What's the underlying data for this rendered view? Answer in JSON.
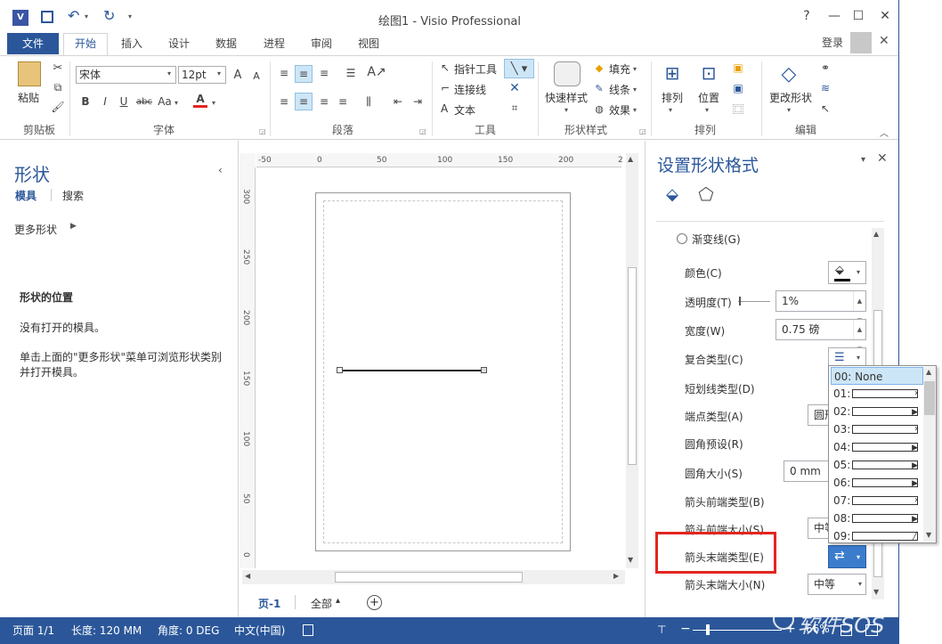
{
  "window": {
    "title": "绘图1 - Visio Professional",
    "help": "?",
    "minimize": "—",
    "restore": "☐",
    "close": "✕",
    "signin": "登录"
  },
  "tabs": [
    "文件",
    "开始",
    "插入",
    "设计",
    "数据",
    "进程",
    "审阅",
    "视图"
  ],
  "ribbon": {
    "clipboard": {
      "paste": "粘贴",
      "label": "剪贴板"
    },
    "font": {
      "name": "宋体",
      "size": "12pt",
      "bold": "B",
      "italic": "I",
      "underline": "U",
      "strike": "abc",
      "case": "Aa",
      "color": "A",
      "label": "字体"
    },
    "paragraph": {
      "label": "段落"
    },
    "tools": {
      "pointer": "指针工具",
      "connector": "连接线",
      "text": "文本",
      "text_icon": "A",
      "label": "工具"
    },
    "shape_styles": {
      "quick": "快速样式",
      "fill": "填充",
      "line": "线条",
      "effect": "效果",
      "label": "形状样式"
    },
    "arrange": {
      "arrange": "排列",
      "position": "位置",
      "label": "排列"
    },
    "editing": {
      "change_shape": "更改形状",
      "label": "编辑"
    }
  },
  "shapes_pane": {
    "title": "形状",
    "tab_stencils": "模具",
    "tab_search": "搜索",
    "more_shapes": "更多形状",
    "section_title": "形状的位置",
    "msg1": "没有打开的模具。",
    "msg2": "单击上面的\"更多形状\"菜单可浏览形状类别并打开模具。"
  },
  "ruler": {
    "h_labels": [
      "-50",
      "0",
      "50",
      "100",
      "150",
      "200",
      "2"
    ],
    "v_labels": [
      "300",
      "250",
      "200",
      "150",
      "100",
      "50",
      "0"
    ]
  },
  "page_tabs": {
    "page1": "页-1",
    "all": "全部",
    "all_arrow": "▴",
    "add": "+"
  },
  "format_pane": {
    "title": "设置形状格式",
    "gradient_line": "渐变线(G)",
    "color": "颜色(C)",
    "transparency": "透明度(T)",
    "transparency_value": "1%",
    "width": "宽度(W)",
    "width_value": "0.75 磅",
    "compound": "复合类型(C)",
    "dash": "短划线类型(D)",
    "cap": "端点类型(A)",
    "cap_value": "圆形",
    "round_preset": "圆角预设(R)",
    "round_size": "圆角大小(S)",
    "round_size_value": "0 mm",
    "begin_arrow": "箭头前端类型(B)",
    "begin_size": "箭头前端大小(S)",
    "begin_size_value": "中等",
    "end_arrow": "箭头末端类型(E)",
    "end_size": "箭头末端大小(N)",
    "end_size_value": "中等"
  },
  "arrow_dropdown": {
    "items": [
      "00: None",
      "01:",
      "02:",
      "03:",
      "04:",
      "05:",
      "06:",
      "07:",
      "08:",
      "09:"
    ]
  },
  "status": {
    "page": "页面 1/1",
    "length": "长度: 120 MM",
    "angle": "角度: 0 DEG",
    "lang": "中文(中国)",
    "zoom": "66%"
  },
  "watermark": "软件SOS"
}
